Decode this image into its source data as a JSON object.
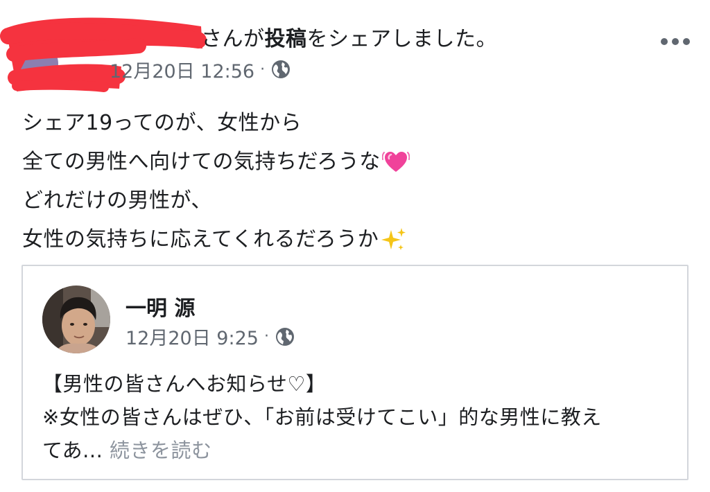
{
  "share_header": {
    "actor_name_redacted": true,
    "share_text_prefix": "さんが",
    "share_text_bold": "投稿",
    "share_text_suffix": "をシェアしました。",
    "timestamp": "12月20日 12:56",
    "separator": "·",
    "privacy_icon": "globe-icon",
    "more_icon": "more-options-icon"
  },
  "post_body": {
    "lines": [
      "シェア19ってのが、女性から",
      "全ての男性へ向けての気持ちだろうな",
      "どれだけの男性が、",
      "女性の気持ちに応えてくれるだろうか"
    ],
    "line2_emoji": "heart-pulse-emoji",
    "line4_emoji": "sparkles-emoji"
  },
  "shared_post": {
    "author_name": "一明 源",
    "timestamp": "12月20日 9:25",
    "separator": "·",
    "privacy_icon": "globe-icon",
    "text_line1": "【男性の皆さんへお知らせ♡】",
    "text_line2": "※女性の皆さんはぜひ、「お前は受けてこい」的な男性に教え",
    "text_line3": "てあ...",
    "see_more_label": "続きを読む"
  },
  "colors": {
    "redaction": "#f5333f",
    "meta_gray": "#606770",
    "see_more_gray": "#8d949e",
    "card_border": "#d3d6db",
    "text": "#1c1e21"
  }
}
